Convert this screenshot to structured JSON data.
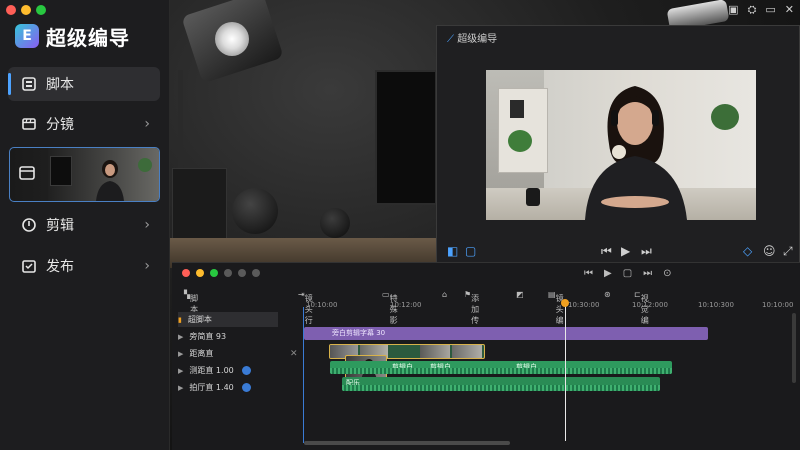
{
  "app": {
    "title": "超级编导",
    "logo_glyph": "E"
  },
  "window_controls": {
    "colors": [
      "#ff5f57",
      "#febc2e",
      "#28c840"
    ]
  },
  "sidebar": {
    "items": [
      {
        "label": "脚本",
        "icon": "script-icon",
        "active": true
      },
      {
        "label": "分镜",
        "icon": "storyboard-icon",
        "chevron": "›"
      },
      {
        "label": "",
        "icon": "storyboard-frame-icon",
        "thumbnail": true
      },
      {
        "label": "剪辑",
        "icon": "edit-clip-icon",
        "chevron": "›"
      },
      {
        "label": "发布",
        "icon": "publish-icon",
        "chevron": "›"
      }
    ]
  },
  "preview": {
    "title": "超级编导",
    "controls": {
      "left": [
        "◧",
        "▢"
      ],
      "center": [
        "⏮",
        "▶",
        "⏭"
      ],
      "right": [
        "◇",
        "☺",
        "⤢"
      ]
    }
  },
  "top_right_icons": [
    "▣",
    "⛭",
    "▭",
    "✕"
  ],
  "timeline": {
    "dot_colors": [
      "#ff5f57",
      "#febc2e",
      "#28c840",
      "#6b6b6b",
      "#6b6b6b",
      "#6b6b6b"
    ],
    "transport": [
      "⏮",
      "▶",
      "▢",
      "⏭",
      "⊙"
    ],
    "toolbar": [
      {
        "label": "脚本"
      },
      {
        "label": "镜头行"
      },
      {
        "label": "特殊影号"
      },
      {
        "label": "添加传说"
      },
      {
        "label": "镜头编号"
      },
      {
        "label": "视觉编号"
      }
    ],
    "ruler": [
      "10:10:00",
      "10:12:00",
      "10:30:00",
      "10:12:000",
      "10:10:300",
      "10:10:00"
    ],
    "tracks": [
      {
        "name": "超脚本",
        "selected": true
      },
      {
        "name": "旁简直 93"
      },
      {
        "name": "距离直"
      },
      {
        "name": "测距直 1.00"
      },
      {
        "name": "拍厅直 1.40"
      }
    ],
    "clip_labels": {
      "script": "旁白剪辑字幕 30",
      "voice_a": "剪辑白",
      "voice_b": "剪辑白",
      "voice_c": "剪辑白",
      "music": "配乐"
    }
  },
  "colors": {
    "accent": "#4da3ff",
    "clip_purple": "#7e5fb0",
    "clip_green": "#2e9a5e",
    "playhead_knob": "#f0a020"
  }
}
